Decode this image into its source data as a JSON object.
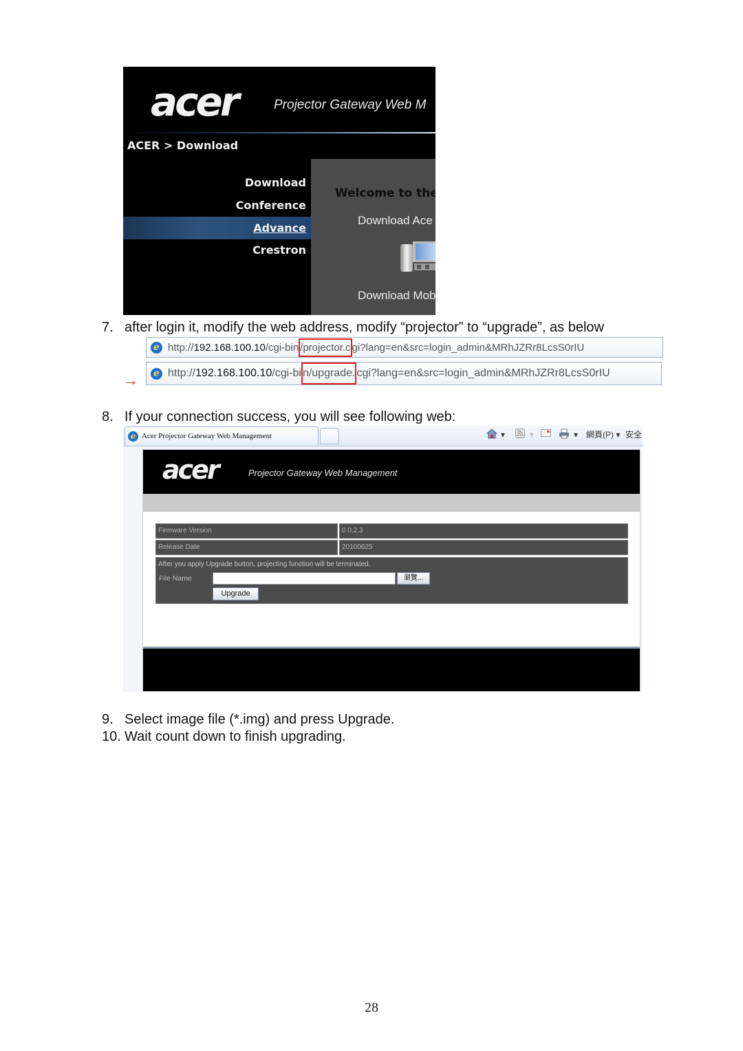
{
  "screenshot1": {
    "logo": "acer",
    "tagline": "Projector Gateway Web M",
    "breadcrumb": "ACER > Download",
    "nav": [
      {
        "label": "Download",
        "active": false
      },
      {
        "label": "Conference",
        "active": false
      },
      {
        "label": "Advance",
        "active": true
      },
      {
        "label": "Crestron",
        "active": false
      }
    ],
    "welcome": "Welcome to the",
    "download_links": [
      "Download Ace",
      "Download Mob"
    ],
    "icon": "computer-icon"
  },
  "steps": {
    "step7": {
      "num": "7.",
      "text": "after login it, modify the web address, modify “projector” to “upgrade”, as below"
    },
    "step8": {
      "num": "8.",
      "text": "If your connection success, you will see following web:"
    },
    "step9": {
      "num": "9.",
      "text": "Select image file (*.img) and press Upgrade."
    },
    "step10": {
      "num": "10.",
      "text": "Wait count down to finish upgrading."
    }
  },
  "url_bars": {
    "arrow": "→",
    "before": {
      "scheme": "http://",
      "host": "192.168.100.10",
      "path_pre": "/cgi-bin",
      "highlight": "/projector.c",
      "path_post": "gi?lang=en&src=login_admin&MRhJZRr8LcsS0rIU"
    },
    "after": {
      "scheme": "http://",
      "host": "192.168.100.10",
      "path_pre": "/cgi-bi",
      "highlight": "n/upgrade.",
      "path_post": "cgi?lang=en&src=login_admin&MRhJZRr8LcsS0rIU"
    }
  },
  "screenshot2": {
    "tab_title": "Acer Projector Gateway Web Management",
    "toolbar": {
      "page_menu": "網頁(P) ▾",
      "safety_menu": "安全"
    },
    "logo": "acer",
    "tagline": "Projector Gateway Web Management",
    "table": [
      {
        "label": "Firmware Version",
        "value": "0.0.2.3"
      },
      {
        "label": "Release Date",
        "value": "20100625"
      }
    ],
    "note": "After you apply Upgrade button, projecting function will be terminated.",
    "file_name_label": "File Name",
    "file_name_value": "",
    "browse_label": "瀏覽...",
    "upgrade_label": "Upgrade"
  },
  "page_number": "28",
  "colors": {
    "highlight_box": "#e02020",
    "nav_active": "#2d527c"
  }
}
